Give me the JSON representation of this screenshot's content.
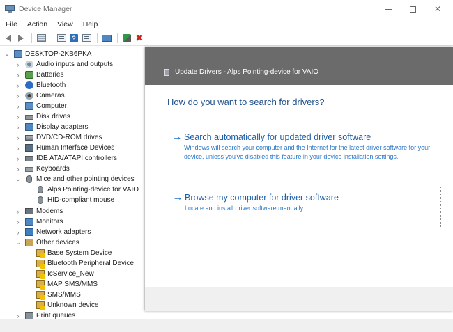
{
  "window": {
    "title": "Device Manager",
    "controls": {
      "minimize": "—",
      "maximize": "☐",
      "close": "✕"
    }
  },
  "menu": [
    "File",
    "Action",
    "View",
    "Help"
  ],
  "toolbar": {
    "icons": [
      "back-arrow-icon",
      "forward-arrow-icon",
      "show-hide-console-icon",
      "properties-icon",
      "help-icon",
      "view-icon",
      "scan-hardware-icon",
      "update-driver-icon",
      "uninstall-icon"
    ]
  },
  "tree": {
    "root": "DESKTOP-2KB6PKA",
    "items": [
      {
        "label": "Audio inputs and outputs",
        "icon": "audio"
      },
      {
        "label": "Batteries",
        "icon": "battery"
      },
      {
        "label": "Bluetooth",
        "icon": "bluetooth"
      },
      {
        "label": "Cameras",
        "icon": "camera"
      },
      {
        "label": "Computer",
        "icon": "computer"
      },
      {
        "label": "Disk drives",
        "icon": "disk"
      },
      {
        "label": "Display adapters",
        "icon": "display"
      },
      {
        "label": "DVD/CD-ROM drives",
        "icon": "dvd"
      },
      {
        "label": "Human Interface Devices",
        "icon": "hid"
      },
      {
        "label": "IDE ATA/ATAPI controllers",
        "icon": "ide"
      },
      {
        "label": "Keyboards",
        "icon": "keyboard"
      },
      {
        "label": "Mice and other pointing devices",
        "icon": "mouse"
      },
      {
        "label": "Alps Pointing-device for VAIO",
        "icon": "mouse"
      },
      {
        "label": "HID-compliant mouse",
        "icon": "mouse"
      },
      {
        "label": "Modems",
        "icon": "modem"
      },
      {
        "label": "Monitors",
        "icon": "monitor"
      },
      {
        "label": "Network adapters",
        "icon": "network"
      },
      {
        "label": "Other devices",
        "icon": "other"
      },
      {
        "label": "Base System Device",
        "icon": "warn"
      },
      {
        "label": "Bluetooth Peripheral Device",
        "icon": "warn"
      },
      {
        "label": "IcService_New",
        "icon": "warn"
      },
      {
        "label": "MAP SMS/MMS",
        "icon": "warn"
      },
      {
        "label": "SMS/MMS",
        "icon": "warn"
      },
      {
        "label": "Unknown device",
        "icon": "warn"
      },
      {
        "label": "Print queues",
        "icon": "print"
      }
    ]
  },
  "dialog": {
    "title": "Update Drivers - Alps Pointing-device for VAIO",
    "heading": "How do you want to search for drivers?",
    "options": [
      {
        "title": "Search automatically for updated driver software",
        "description": "Windows will search your computer and the Internet for the latest driver software for your device, unless you've disabled this feature in your device installation settings."
      },
      {
        "title": "Browse my computer for driver software",
        "description": "Locate and install driver software manually."
      }
    ]
  }
}
